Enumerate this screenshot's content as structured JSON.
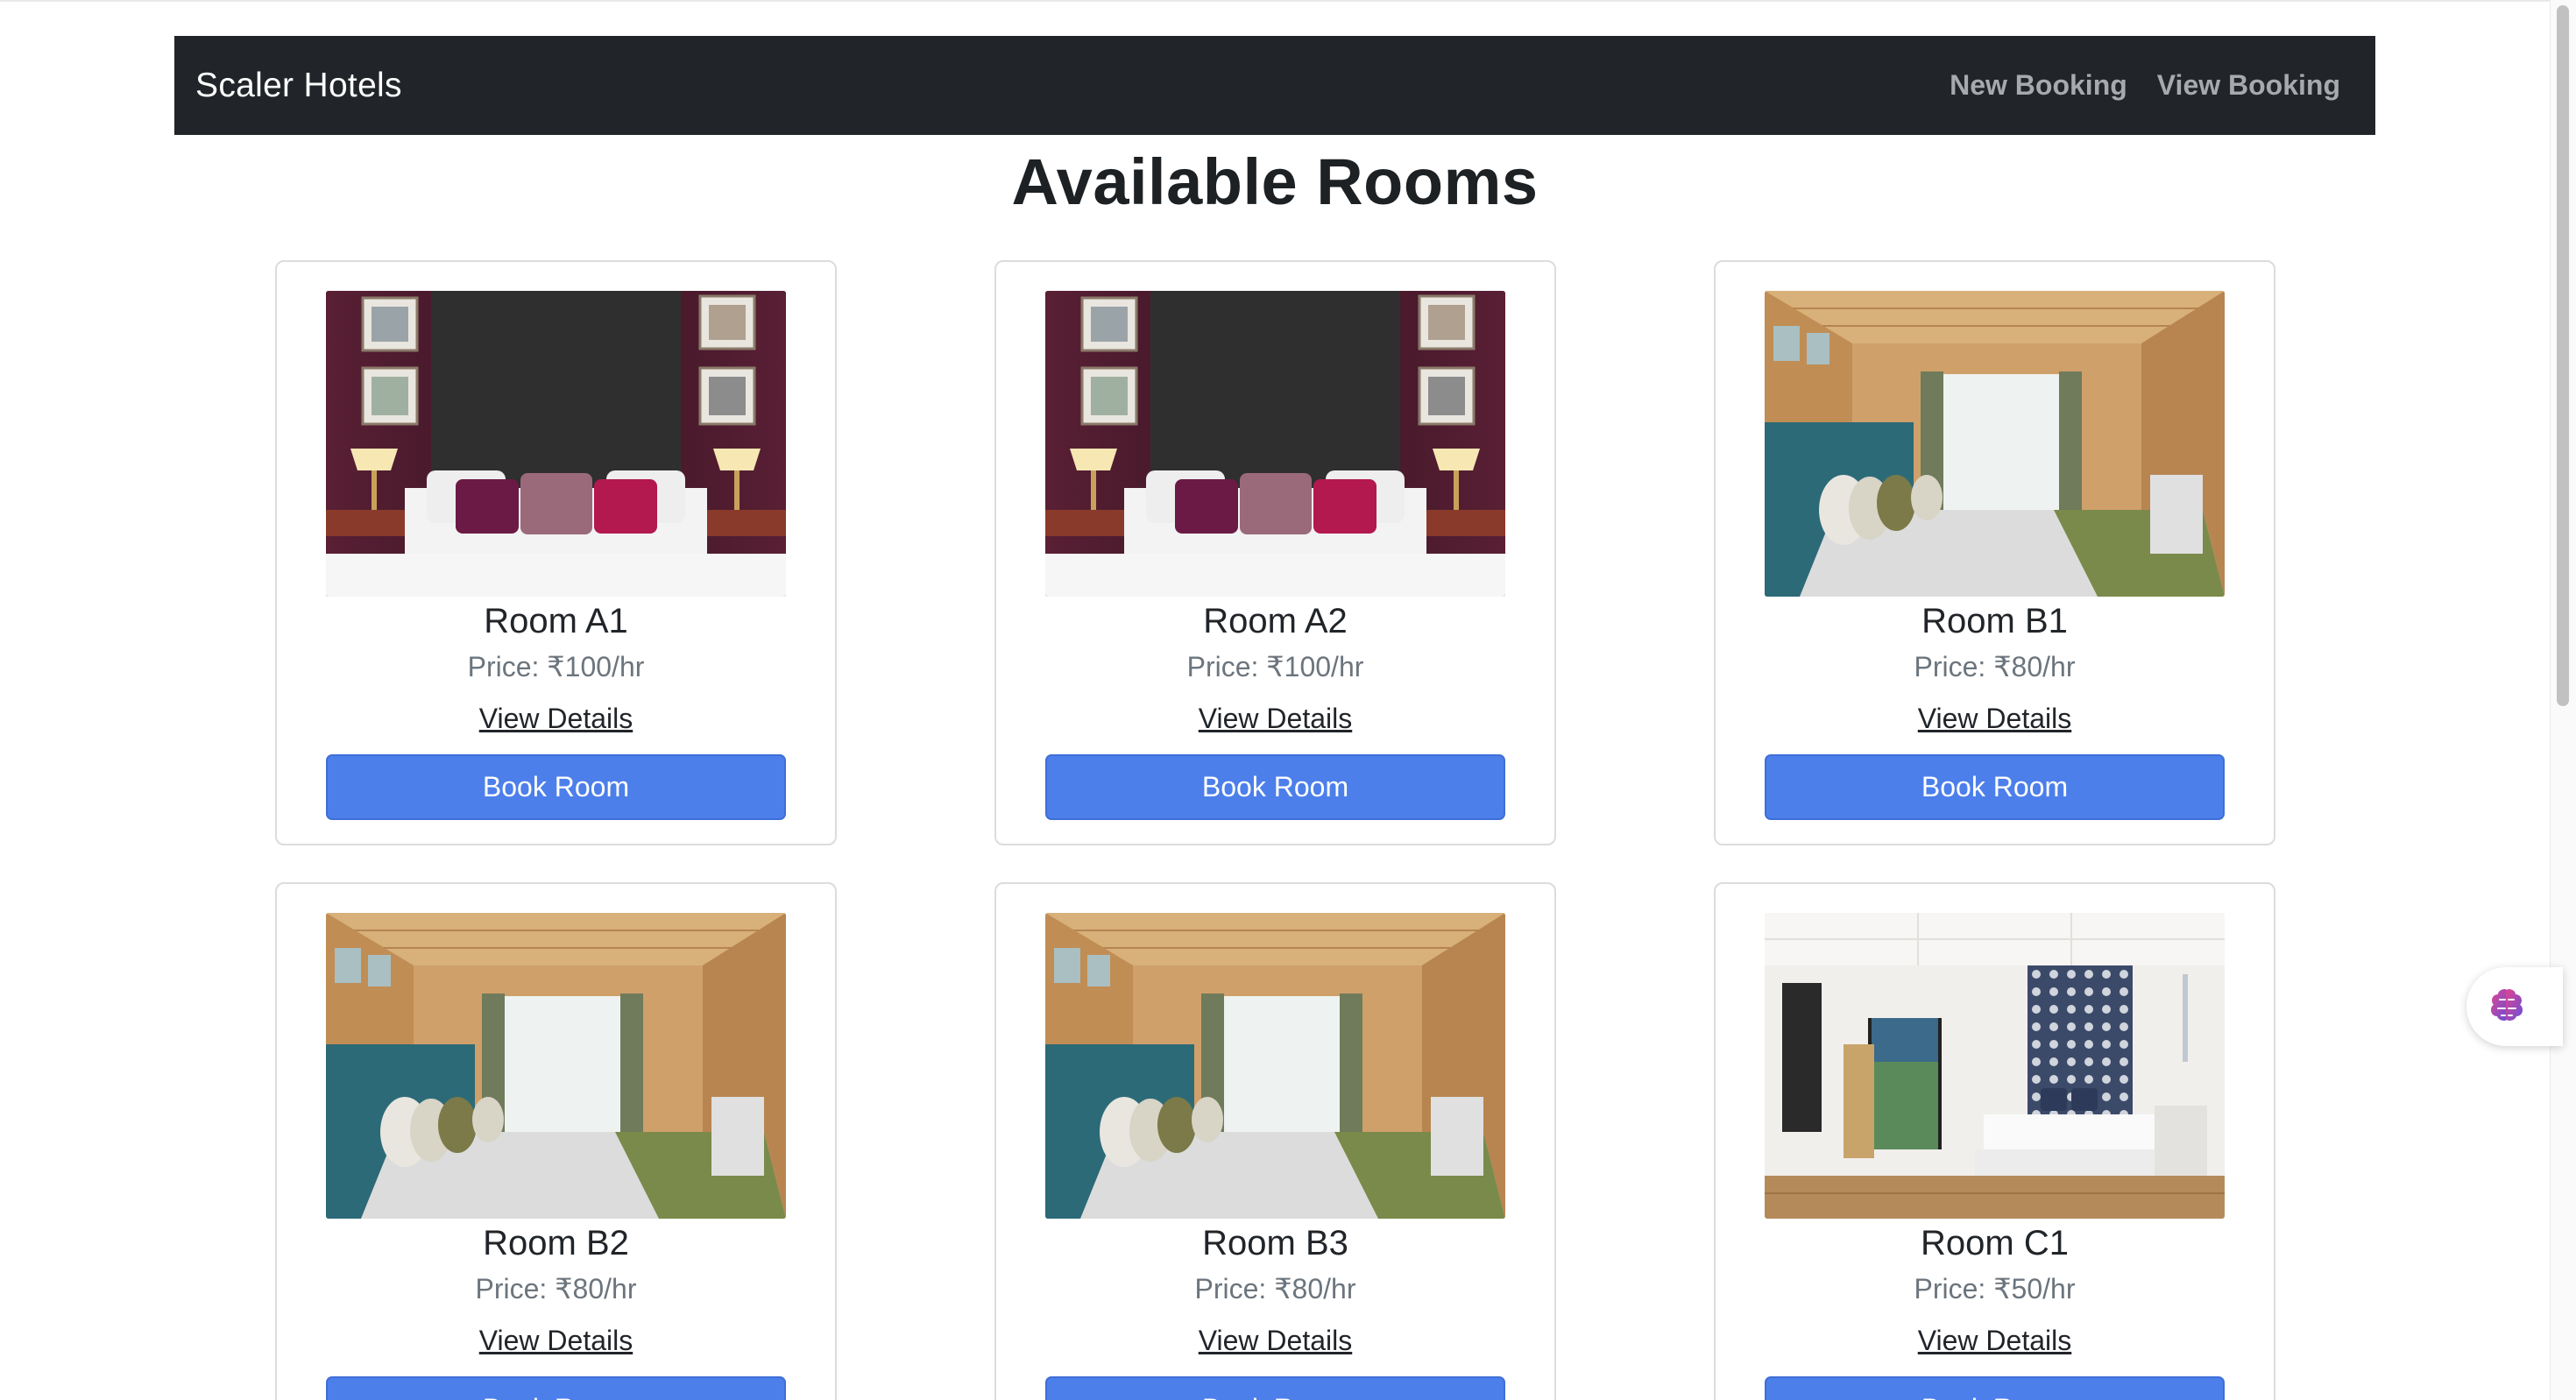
{
  "navbar": {
    "brand": "Scaler Hotels",
    "links": [
      "New Booking",
      "View Booking"
    ]
  },
  "page_title": "Available Rooms",
  "rooms": [
    {
      "name": "Room A1",
      "price": "Price: ₹100/hr",
      "details_label": "View Details",
      "book_label": "Book Room",
      "image": "maroon-wall-bedroom"
    },
    {
      "name": "Room A2",
      "price": "Price: ₹100/hr",
      "details_label": "View Details",
      "book_label": "Book Room",
      "image": "maroon-wall-bedroom"
    },
    {
      "name": "Room B1",
      "price": "Price: ₹80/hr",
      "details_label": "View Details",
      "book_label": "Book Room",
      "image": "wooden-cabin-bedroom"
    },
    {
      "name": "Room B2",
      "price": "Price: ₹80/hr",
      "details_label": "View Details",
      "book_label": "Book Room",
      "image": "wooden-cabin-bedroom"
    },
    {
      "name": "Room B3",
      "price": "Price: ₹80/hr",
      "details_label": "View Details",
      "book_label": "Book Room",
      "image": "wooden-cabin-bedroom"
    },
    {
      "name": "Room C1",
      "price": "Price: ₹50/hr",
      "details_label": "View Details",
      "book_label": "Book Room",
      "image": "white-modern-bedroom"
    }
  ],
  "floating_widget": {
    "icon": "brain-icon"
  },
  "colors": {
    "navbar_bg": "#212529",
    "button_bg": "#4c7fea",
    "price_text": "#6c757d"
  }
}
